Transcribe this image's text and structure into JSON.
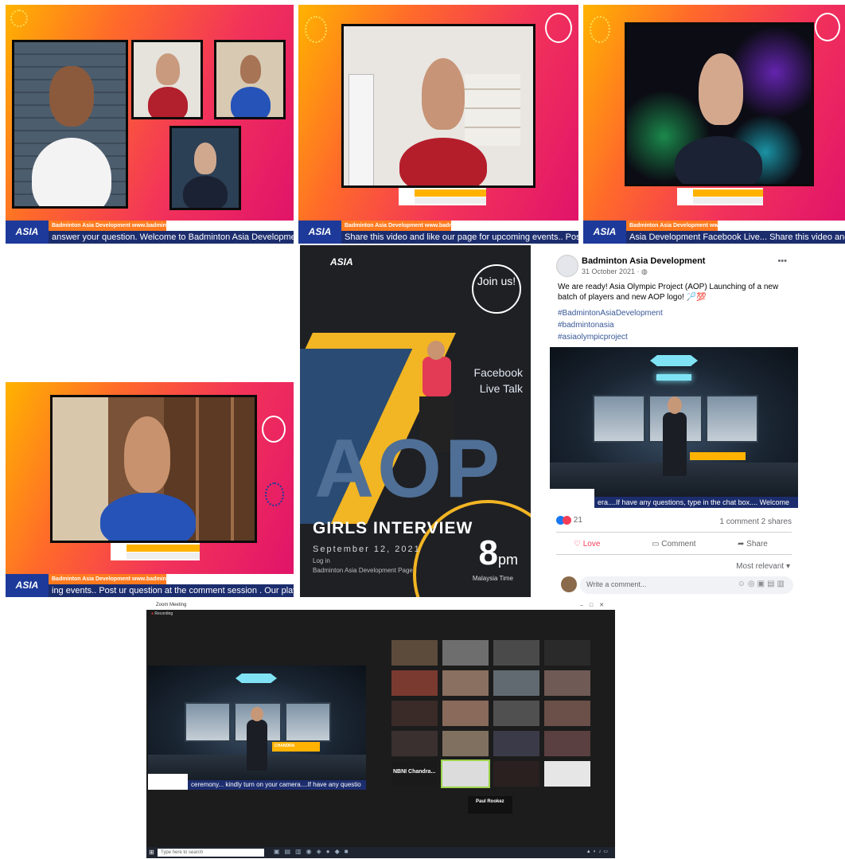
{
  "panel1": {
    "ticker_info": "Badminton Asia Development   www.badmintonasia.org",
    "ticker_text": "answer your question.     Welcome to Badminton Asia Development Facebo",
    "logo": "ASIA"
  },
  "panel2": {
    "ticker_info": "Badminton Asia Development   www.badmintonasia.org",
    "ticker_text": "Share this video and like our page for upcoming events.. Post ur question",
    "logo": "ASIA"
  },
  "panel3": {
    "ticker_info": "Badminton Asia Development   www.badmintonasia.org",
    "ticker_text": "Asia Development Facebook Live... Share this video and like our page for",
    "logo": "ASIA"
  },
  "panel4": {
    "ticker_info": "Badminton Asia Development   www.badmintonasia.org",
    "ticker_text": "ing events.. Post ur question at the comment session . Our players will ans",
    "logo": "ASIA"
  },
  "poster": {
    "brand": "ASIA",
    "join": "Join us!",
    "fb_live": "Facebook Live Talk",
    "big": "AOP",
    "title": "GIRLS INTERVIEW",
    "date": "September 12, 2021",
    "login": "Log in",
    "page": "Badminton Asia Development Page",
    "time": "8",
    "time_unit": "pm",
    "tz": "Malaysia Time"
  },
  "facebook": {
    "page_name": "Badminton Asia Development",
    "date": "31 October 2021 · ",
    "text": "We are ready! Asia Olympic Project (AOP) Launching of a new batch of players and new AOP logo! ",
    "tags": [
      "#BadmintonAsiaDevelopment",
      "#badmintonasia",
      "#asiaolympicproject"
    ],
    "video_ticker": "era....If have any questions, type in the chat box....  Welcome",
    "reactions": "21",
    "comments_shares": "1 comment  2 shares",
    "love": "Love",
    "comment": "Comment",
    "share": "Share",
    "most_relevant": "Most relevant ▾",
    "write_placeholder": "Write a comment..."
  },
  "zoom": {
    "title": "Zoom Meeting",
    "recording": "Recording",
    "ticker_text": "ceremony... kindly turn on your camera....If have any questio",
    "speaker_label": "NBNI Chandra...",
    "caption": "Paul Rookez",
    "taskbar_search": "Type here to search",
    "host_title": "CHANDRA"
  },
  "colors": {
    "accent_orange": "#ff7a1f",
    "ticker_blue": "#1c2d6e",
    "fb_blue": "#385898"
  }
}
